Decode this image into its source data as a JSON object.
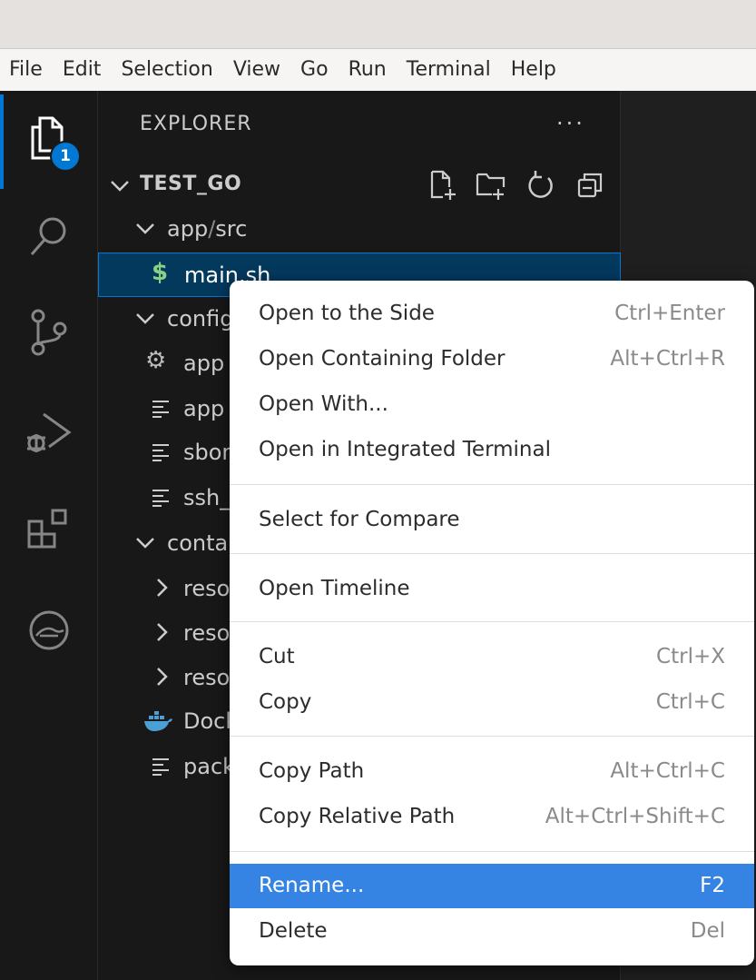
{
  "menubar": {
    "items": [
      "File",
      "Edit",
      "Selection",
      "View",
      "Go",
      "Run",
      "Terminal",
      "Help"
    ]
  },
  "activitybar": {
    "items": [
      {
        "name": "explorer",
        "icon": "files-icon"
      },
      {
        "name": "search",
        "icon": "search-icon"
      },
      {
        "name": "source-control",
        "icon": "source-control-icon"
      },
      {
        "name": "run-debug",
        "icon": "run-debug-icon"
      },
      {
        "name": "extensions",
        "icon": "extensions-icon"
      },
      {
        "name": "remote",
        "icon": "remote-explorer-icon"
      }
    ],
    "badge": "1"
  },
  "sidebar": {
    "title": "EXPLORER",
    "more": "···",
    "workspace": "TEST_GO",
    "tree": [
      {
        "label": "app",
        "sep": "/",
        "label2": "src"
      },
      {
        "label": "main.sh"
      },
      {
        "label": "config"
      },
      {
        "label": "app"
      },
      {
        "label": "app"
      },
      {
        "label": "sbom"
      },
      {
        "label": "ssh_"
      },
      {
        "label": "container"
      },
      {
        "label": "reso"
      },
      {
        "label": "reso"
      },
      {
        "label": "reso"
      },
      {
        "label": "Dockerfile"
      },
      {
        "label": "pack"
      }
    ]
  },
  "context_menu": {
    "items": [
      {
        "label": "Open to the Side",
        "shortcut": "Ctrl+Enter"
      },
      {
        "label": "Open Containing Folder",
        "shortcut": "Alt+Ctrl+R"
      },
      {
        "label": "Open With...",
        "shortcut": ""
      },
      {
        "label": "Open in Integrated Terminal",
        "shortcut": ""
      },
      {
        "label": "Select for Compare",
        "shortcut": ""
      },
      {
        "label": "Open Timeline",
        "shortcut": ""
      },
      {
        "label": "Cut",
        "shortcut": "Ctrl+X"
      },
      {
        "label": "Copy",
        "shortcut": "Ctrl+C"
      },
      {
        "label": "Copy Path",
        "shortcut": "Alt+Ctrl+C"
      },
      {
        "label": "Copy Relative Path",
        "shortcut": "Alt+Ctrl+Shift+C"
      },
      {
        "label": "Rename...",
        "shortcut": "F2"
      },
      {
        "label": "Delete",
        "shortcut": "Del"
      }
    ],
    "highlight_color": "#3584e4"
  },
  "colors": {
    "accent": "#0078d4",
    "selection": "#04395e",
    "shell_icon": "#89d185",
    "docker_icon": "#4b9fd5"
  }
}
